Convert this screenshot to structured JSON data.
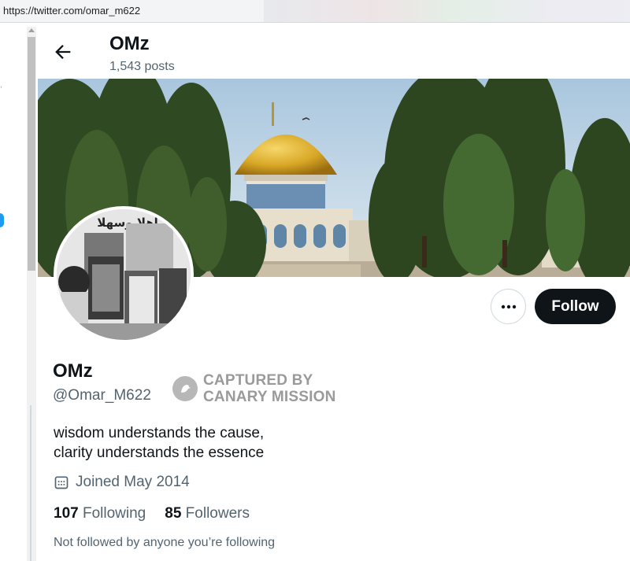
{
  "browser": {
    "url": "https://twitter.com/omar_m622"
  },
  "header": {
    "title": "OMz",
    "posts": "1,543 posts"
  },
  "avatar": {
    "overlay_text": "اهلا وسهلا"
  },
  "actions": {
    "follow_label": "Follow",
    "more_icon": "more-dots-icon"
  },
  "profile": {
    "name": "OMz",
    "handle": "@Omar_M622",
    "bio_line1": "wisdom understands the cause,",
    "bio_line2": "clarity understands the essence",
    "joined": "Joined May 2014",
    "following_count": "107",
    "following_label": "Following",
    "followers_count": "85",
    "followers_label": "Followers",
    "not_followed": "Not followed by anyone you’re following"
  },
  "watermark": {
    "line1": "CAPTURED BY",
    "line2": "CANARY MISSION"
  },
  "colors": {
    "follow_bg": "#0f1419",
    "secondary_text": "#536471",
    "accent": "#1d9bf0"
  }
}
